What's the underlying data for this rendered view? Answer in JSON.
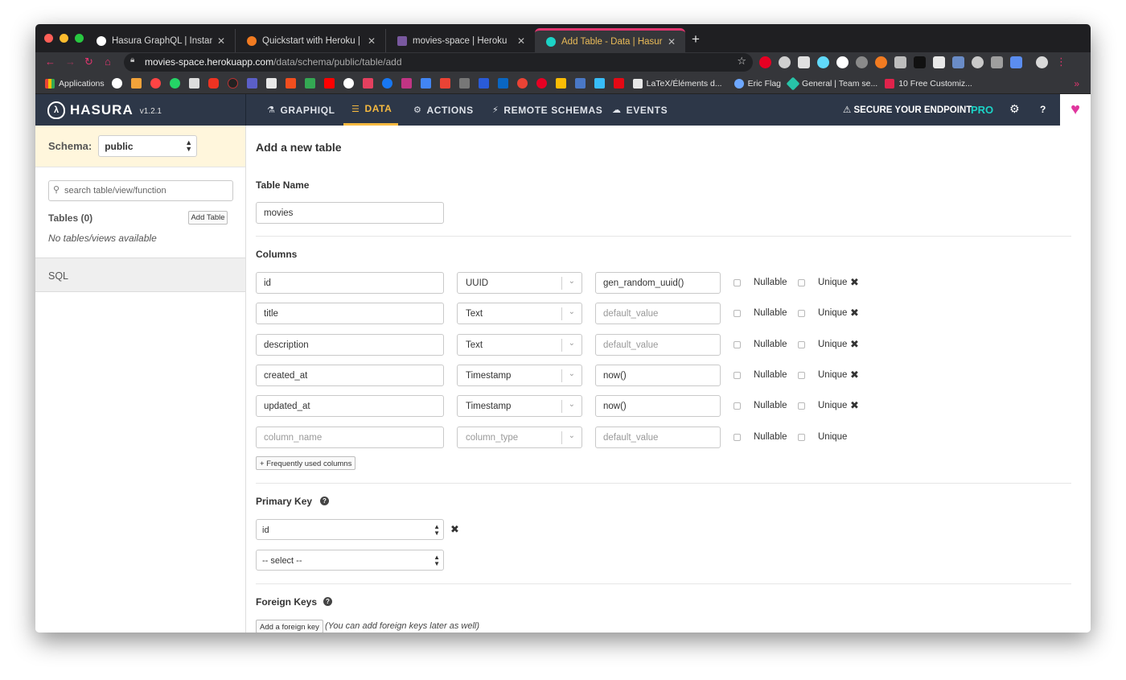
{
  "browser": {
    "tabs": [
      {
        "title": "Hasura GraphQL | Instant Grap",
        "favicon_color": "#ffffff"
      },
      {
        "title": "Quickstart with Heroku | Hasur",
        "favicon_color": "#f27b21"
      },
      {
        "title": "movies-space | Heroku",
        "favicon_color": "#79589f"
      },
      {
        "title": "Add Table - Data | Hasura",
        "favicon_color": "#1cd3c6"
      }
    ],
    "url_host": "movies-space.herokuapp.com",
    "url_path": "/data/schema/public/table/add",
    "bookmarks": {
      "apps_label": "Applications",
      "named": [
        {
          "label": "LaTeX/Éléments d...",
          "color": "#e8e8e8"
        },
        {
          "label": "Eric Flag",
          "color": "#6ea8ff"
        },
        {
          "label": "General | Team se...",
          "color": "#27c4a8"
        },
        {
          "label": "10 Free Customiz...",
          "color": "#e0234b"
        }
      ],
      "more": "»"
    }
  },
  "app": {
    "brand": "HASURA",
    "version": "v1.2.1",
    "nav": [
      {
        "label": "GRAPHIQL",
        "icon": "flask-icon"
      },
      {
        "label": "DATA",
        "icon": "database-icon"
      },
      {
        "label": "ACTIONS",
        "icon": "cogs-icon"
      },
      {
        "label": "REMOTE SCHEMAS",
        "icon": "plug-icon"
      },
      {
        "label": "EVENTS",
        "icon": "cloud-icon"
      }
    ],
    "secure": "SECURE YOUR ENDPOINT",
    "pro": "PRO",
    "help": "?",
    "accent": "#f5b940"
  },
  "sidebar": {
    "schema_label": "Schema:",
    "schema_value": "public",
    "search_placeholder": "search table/view/function",
    "tables_label": "Tables (0)",
    "add_table": "Add Table",
    "empty": "No tables/views available",
    "sql": "SQL"
  },
  "main": {
    "title": "Add a new table",
    "table_name_label": "Table Name",
    "table_name_value": "movies",
    "columns_label": "Columns",
    "nullable_label": "Nullable",
    "unique_label": "Unique",
    "columns": [
      {
        "name": "id",
        "type": "UUID",
        "default": "gen_random_uuid()"
      },
      {
        "name": "title",
        "type": "Text",
        "default": ""
      },
      {
        "name": "description",
        "type": "Text",
        "default": ""
      },
      {
        "name": "created_at",
        "type": "Timestamp",
        "default": "now()"
      },
      {
        "name": "updated_at",
        "type": "Timestamp",
        "default": "now()"
      }
    ],
    "new_column": {
      "name_ph": "column_name",
      "type_ph": "column_type",
      "default_ph": "default_value"
    },
    "default_placeholder": "default_value",
    "freq_columns": "+ Frequently used columns",
    "pk_label": "Primary Key",
    "pk_value": "id",
    "pk_select": "-- select --",
    "fk_label": "Foreign Keys",
    "fk_button": "Add a foreign key",
    "fk_note": "(You can add foreign keys later as well)"
  }
}
